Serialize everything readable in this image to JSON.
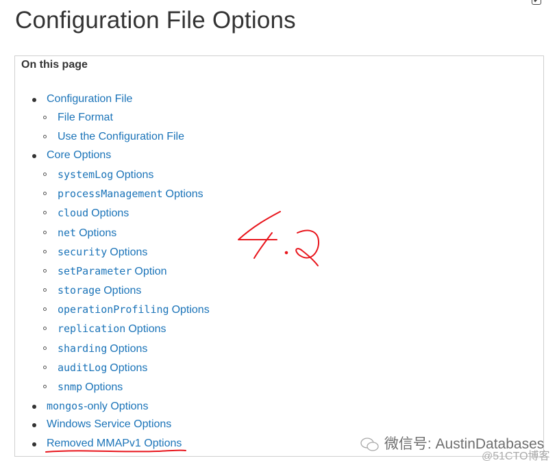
{
  "page": {
    "title": "Configuration File Options"
  },
  "toc": {
    "heading": "On this page",
    "items": [
      {
        "label": "Configuration File",
        "level": 1
      },
      {
        "label": "File Format",
        "level": 2
      },
      {
        "label": "Use the Configuration File",
        "level": 2
      },
      {
        "label": "Core Options",
        "level": 1
      },
      {
        "code": "systemLog",
        "label": "Options",
        "level": 2
      },
      {
        "code": "processManagement",
        "label": "Options",
        "level": 2
      },
      {
        "code": "cloud",
        "label": "Options",
        "level": 2
      },
      {
        "code": "net",
        "label": "Options",
        "level": 2
      },
      {
        "code": "security",
        "label": "Options",
        "level": 2
      },
      {
        "code": "setParameter",
        "label": "Option",
        "level": 2
      },
      {
        "code": "storage",
        "label": "Options",
        "level": 2
      },
      {
        "code": "operationProfiling",
        "label": "Options",
        "level": 2
      },
      {
        "code": "replication",
        "label": "Options",
        "level": 2
      },
      {
        "code": "sharding",
        "label": "Options",
        "level": 2
      },
      {
        "code": "auditLog",
        "label": "Options",
        "level": 2
      },
      {
        "code": "snmp",
        "label": "Options",
        "level": 2
      },
      {
        "code": "mongos",
        "label": "-only Options",
        "level": 1
      },
      {
        "label": "Windows Service Options",
        "level": 1
      },
      {
        "label": "Removed MMAPv1 Options",
        "level": 1
      }
    ]
  },
  "annotation": {
    "handwritten_text": "4.2",
    "color": "#e8141b"
  },
  "watermark": {
    "text": "微信号: AustinDatabases",
    "source": "@51CTO博客"
  },
  "colors": {
    "link": "#1a73b8",
    "text": "#333333",
    "border": "#cfcfcf"
  }
}
